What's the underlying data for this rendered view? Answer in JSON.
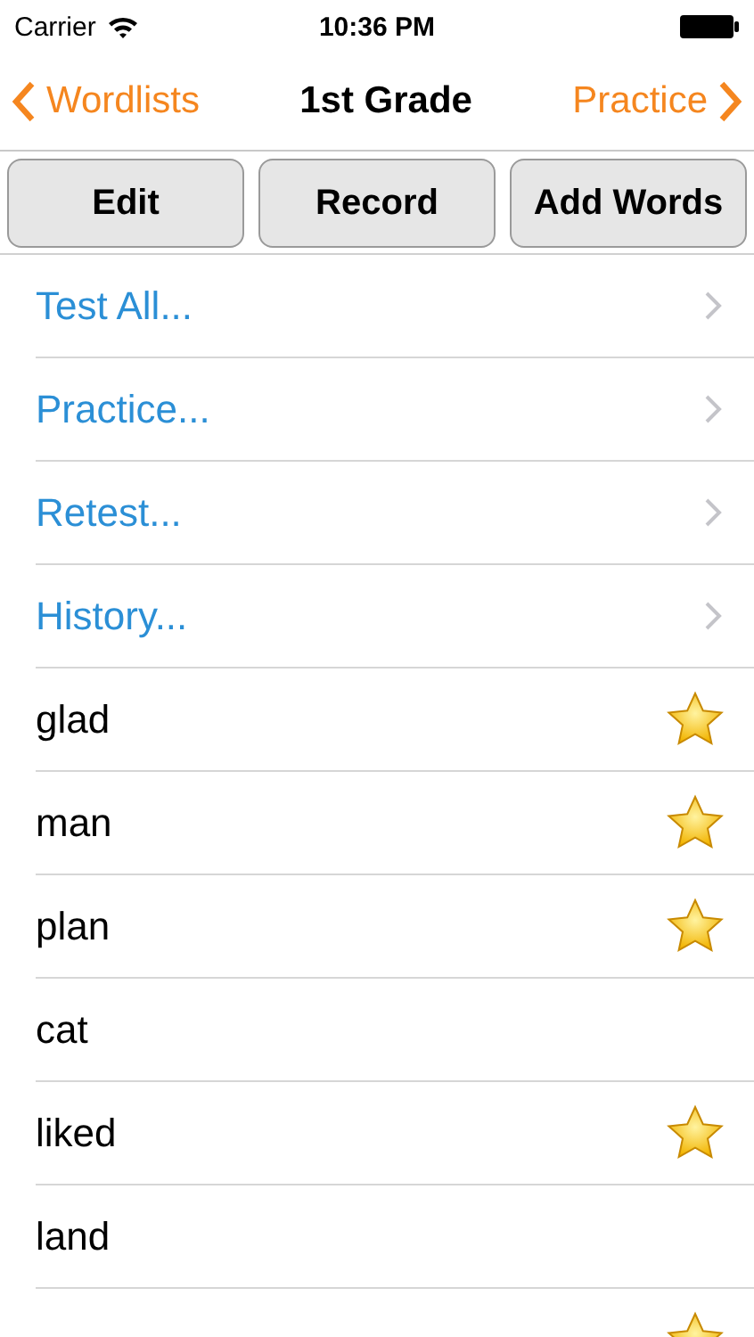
{
  "status_bar": {
    "carrier": "Carrier",
    "time": "10:36 PM"
  },
  "nav": {
    "back": "Wordlists",
    "title": "1st Grade",
    "forward": "Practice"
  },
  "buttons": [
    "Edit",
    "Record",
    "Add Words"
  ],
  "rows": [
    {
      "kind": "action",
      "label": "Test All..."
    },
    {
      "kind": "action",
      "label": "Practice..."
    },
    {
      "kind": "action",
      "label": "Retest..."
    },
    {
      "kind": "action",
      "label": "History..."
    },
    {
      "kind": "word",
      "label": "glad",
      "starred": true
    },
    {
      "kind": "word",
      "label": "man",
      "starred": true
    },
    {
      "kind": "word",
      "label": "plan",
      "starred": true
    },
    {
      "kind": "word",
      "label": "cat",
      "starred": false
    },
    {
      "kind": "word",
      "label": "liked",
      "starred": true
    },
    {
      "kind": "word",
      "label": "land",
      "starred": false
    },
    {
      "kind": "word",
      "starred": true
    }
  ]
}
